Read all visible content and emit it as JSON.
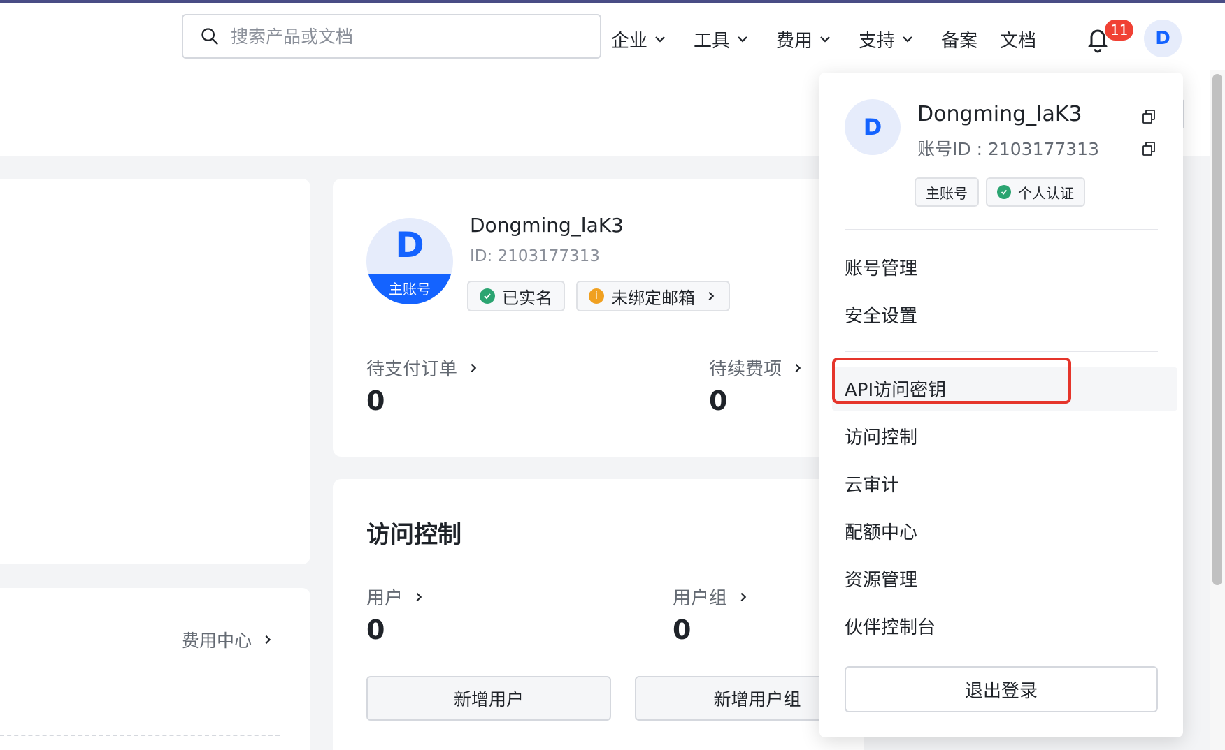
{
  "header": {
    "search_placeholder": "搜索产品或文档",
    "nav": [
      {
        "label": "企业",
        "dropdown": true
      },
      {
        "label": "工具",
        "dropdown": true
      },
      {
        "label": "费用",
        "dropdown": true
      },
      {
        "label": "支持",
        "dropdown": true
      },
      {
        "label": "备案",
        "dropdown": false
      },
      {
        "label": "文档",
        "dropdown": false
      }
    ],
    "notification_count": "11",
    "avatar_letter": "D"
  },
  "profile": {
    "avatar_letter": "D",
    "role_label": "主账号",
    "name": "Dongming_laK3",
    "id_text": "ID: 2103177313",
    "verified_tag": "已实名",
    "email_tag": "未绑定邮箱"
  },
  "orders": {
    "pending_payment_label": "待支付订单",
    "pending_payment_value": "0",
    "pending_renewal_label": "待续费项",
    "pending_renewal_value": "0"
  },
  "fees": {
    "link_label": "费用中心"
  },
  "access_control": {
    "title": "访问控制",
    "users_label": "用户",
    "users_value": "0",
    "groups_label": "用户组",
    "groups_value": "0",
    "add_user_button": "新增用户",
    "add_group_button": "新增用户组"
  },
  "dropdown": {
    "avatar_letter": "D",
    "name": "Dongming_laK3",
    "account_id": "账号ID : 2103177313",
    "tags": [
      "主账号",
      "个人认证"
    ],
    "group1": [
      "账号管理",
      "安全设置"
    ],
    "group2": [
      "API访问密钥",
      "访问控制",
      "云审计",
      "配额中心",
      "资源管理",
      "伙伴控制台"
    ],
    "logout": "退出登录"
  },
  "colors": {
    "accent": "#1463ff",
    "highlight_border": "#e5352b",
    "badge": "#f04134",
    "success": "#2ba471",
    "warning": "#f0a020"
  }
}
